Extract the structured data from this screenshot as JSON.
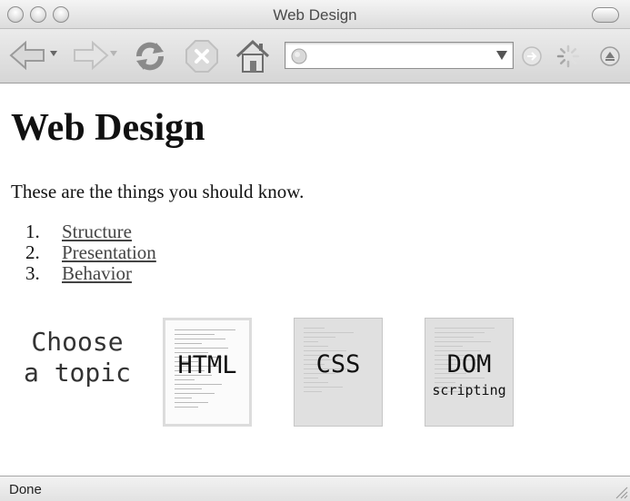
{
  "window": {
    "title": "Web Design"
  },
  "toolbar": {
    "address_value": ""
  },
  "page": {
    "heading": "Web Design",
    "intro": "These are the things you should know.",
    "topics": [
      {
        "number": "1.",
        "label": "Structure"
      },
      {
        "number": "2.",
        "label": "Presentation"
      },
      {
        "number": "3.",
        "label": "Behavior"
      }
    ],
    "choose": {
      "line1": "Choose",
      "line2": "a topic"
    },
    "thumbnails": [
      {
        "label": "HTML"
      },
      {
        "label": "CSS"
      },
      {
        "label": "DOM",
        "sublabel": "scripting"
      }
    ]
  },
  "status": {
    "text": "Done"
  },
  "colors": {
    "toolbar_bg": "#dcdcdc",
    "link": "#444444",
    "thumb_bg": "#e0e0e0"
  },
  "icons": [
    "back-arrow-icon",
    "forward-arrow-icon",
    "reload-icon",
    "stop-icon",
    "home-icon",
    "globe-icon",
    "dropdown-arrow-icon",
    "go-arrow-icon",
    "loading-spinner-icon",
    "search-icon",
    "resize-grip-icon"
  ]
}
